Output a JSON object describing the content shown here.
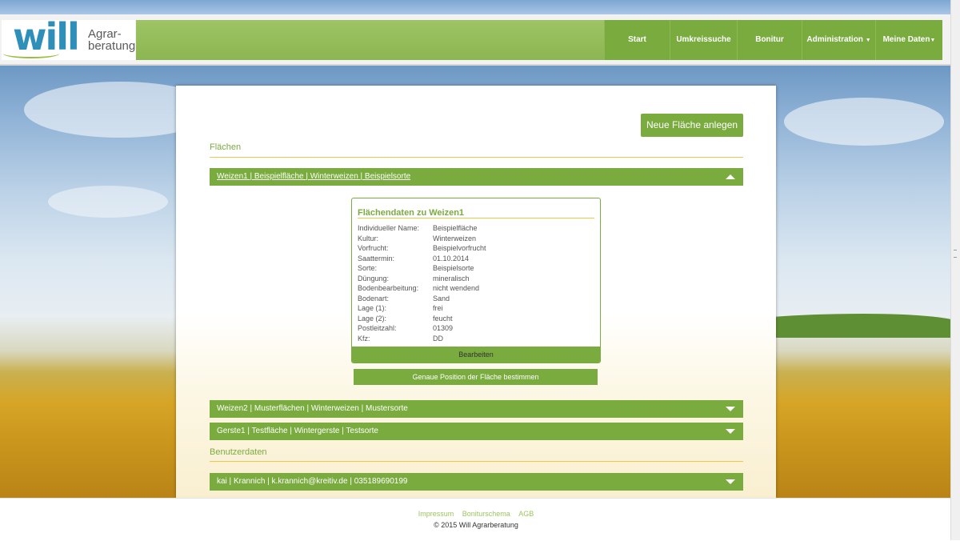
{
  "brand": {
    "logo_main": "will",
    "logo_sub1": "Agrar-",
    "logo_sub2": "beratung"
  },
  "nav": {
    "items": [
      {
        "label": "Start"
      },
      {
        "label": "Umkreissuche"
      },
      {
        "label": "Bonitur"
      },
      {
        "label": "Administration"
      },
      {
        "label": "Meine Daten"
      }
    ],
    "caret": "▼"
  },
  "main": {
    "new_area_button": "Neue Fläche anlegen",
    "areas_title": "Flächen",
    "areas": [
      {
        "label": "Weizen1 | Beispielfläche | Winterweizen | Beispielsorte",
        "expanded": true
      },
      {
        "label": "Weizen2 | Musterflächen | Winterweizen | Mustersorte",
        "expanded": false
      },
      {
        "label": "Gerste1 | Testfläche | Wintergerste | Testsorte",
        "expanded": false
      }
    ],
    "detail": {
      "title": "Flächendaten zu Weizen1",
      "fields": [
        {
          "key": "Individueller Name:",
          "value": "Beispielfläche"
        },
        {
          "key": "Kultur:",
          "value": "Winterweizen"
        },
        {
          "key": "Vorfrucht:",
          "value": "Beispielvorfrucht"
        },
        {
          "key": "Saattermin:",
          "value": "01.10.2014"
        },
        {
          "key": "Sorte:",
          "value": "Beispielsorte"
        },
        {
          "key": "Düngung:",
          "value": "mineralisch"
        },
        {
          "key": "Bodenbearbeitung:",
          "value": "nicht wendend"
        },
        {
          "key": "Bodenart:",
          "value": "Sand"
        },
        {
          "key": "Lage (1):",
          "value": "frei"
        },
        {
          "key": "Lage (2):",
          "value": "feucht"
        },
        {
          "key": "Postleitzahl:",
          "value": "01309"
        },
        {
          "key": "Kfz:",
          "value": "DD"
        }
      ],
      "edit_button": "Bearbeiten"
    },
    "position_button": "Genaue Position der Fläche bestimmen",
    "user_title": "Benutzerdaten",
    "user_row": "kai | Krannich | k.krannich@kreitiv.de | 035189690199"
  },
  "footer": {
    "links": [
      "Impressum",
      "Boniturschema",
      "AGB"
    ],
    "copyright": "© 2015 Will Agrarberatung"
  },
  "colors": {
    "accent_green": "#7aab3e",
    "rule_yellow": "#f0c64a",
    "logo_blue": "#2e8fb8"
  }
}
